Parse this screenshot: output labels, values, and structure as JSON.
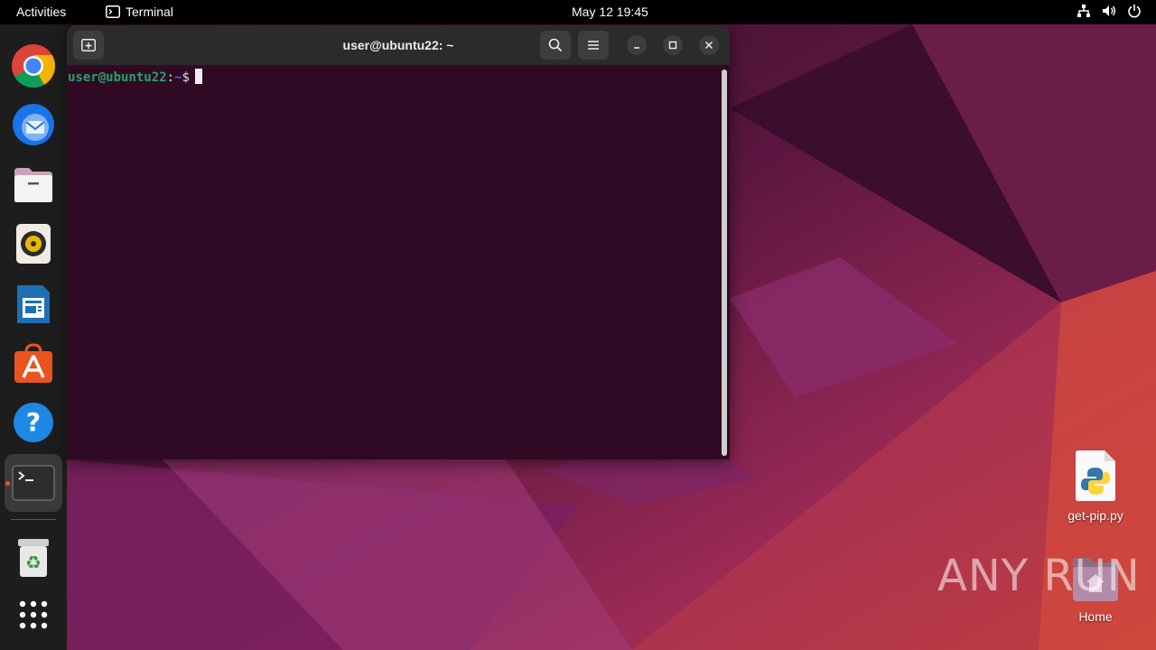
{
  "topbar": {
    "activities": "Activities",
    "app_name": "Terminal",
    "clock": "May 12  19:45"
  },
  "dock": {
    "items": [
      {
        "name": "chrome-icon"
      },
      {
        "name": "thunderbird-icon"
      },
      {
        "name": "files-icon"
      },
      {
        "name": "rhythmbox-icon"
      },
      {
        "name": "writer-icon"
      },
      {
        "name": "app-center-icon"
      },
      {
        "name": "help-icon"
      },
      {
        "name": "terminal-icon",
        "active": true
      },
      {
        "name": "trash-icon"
      },
      {
        "name": "show-apps-icon"
      }
    ]
  },
  "terminal": {
    "title": "user@ubuntu22: ~",
    "prompt_user": "user@ubuntu22",
    "prompt_colon": ":",
    "prompt_path": "~",
    "prompt_symbol": "$"
  },
  "desktop": {
    "icons": [
      {
        "label": "get-pip.py"
      },
      {
        "label": "Home"
      }
    ],
    "watermark": "ANY RUN"
  },
  "colors": {
    "accent": "#e95420",
    "terminal_bg": "#300a24"
  }
}
